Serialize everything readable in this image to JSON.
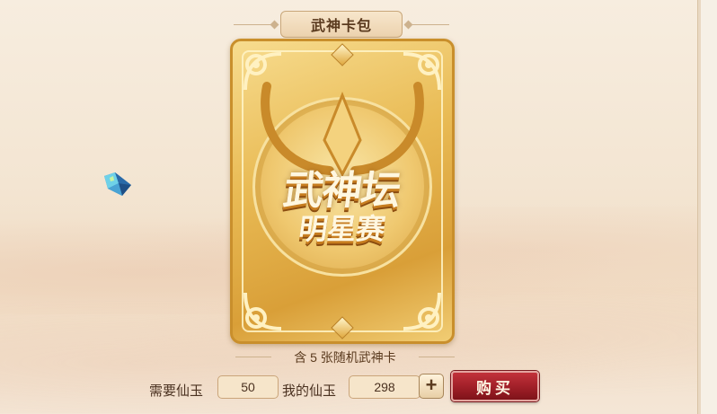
{
  "title": "武神卡包",
  "card": {
    "title": "武神坛",
    "subtitle": "明星赛"
  },
  "description": "含 5 张随机武神卡",
  "purchase": {
    "required_label": "需要仙玉",
    "required_value": "50",
    "mine_label": "我的仙玉",
    "mine_value": "298",
    "add_label": "+",
    "buy_label": "购买"
  },
  "colors": {
    "buy_button": "#9c1d26",
    "card_gold": "#e9bb55",
    "text_brown": "#5a3a1e"
  }
}
